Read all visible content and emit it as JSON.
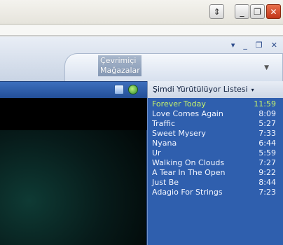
{
  "window": {
    "scroll_glyph": "⇕",
    "minimize_glyph": "_",
    "maximize_glyph": "❐",
    "close_glyph": "✕"
  },
  "header": {
    "menu_caret": "▾",
    "minimize_glyph": "_",
    "restore_glyph": "❐",
    "close_glyph": "✕",
    "store_tab": "Çevrimiçi Mağazalar",
    "store_caret": "▼"
  },
  "toolbar": {
    "icons": [
      "view-switch-icon",
      "update-icon"
    ]
  },
  "playlist": {
    "title": "Şimdi Yürütülüyor Listesi",
    "caret": "▾",
    "items": [
      {
        "title": "Forever Today",
        "duration": "11:59",
        "active": true
      },
      {
        "title": "Love Comes Again",
        "duration": "8:09"
      },
      {
        "title": "Traffic",
        "duration": "5:27"
      },
      {
        "title": "Sweet Mysery",
        "duration": "7:33"
      },
      {
        "title": "Nyana",
        "duration": "6:44"
      },
      {
        "title": "Ur",
        "duration": "5:59"
      },
      {
        "title": "Walking On Clouds",
        "duration": "7:27"
      },
      {
        "title": "A Tear In The Open",
        "duration": "9:22"
      },
      {
        "title": "Just Be",
        "duration": "8:44"
      },
      {
        "title": "Adagio For Strings",
        "duration": "7:23"
      }
    ]
  },
  "colors": {
    "active_track": "#c6f26b",
    "playlist_bg": "#2f5fae",
    "toolbar": "#2c5aa6"
  }
}
